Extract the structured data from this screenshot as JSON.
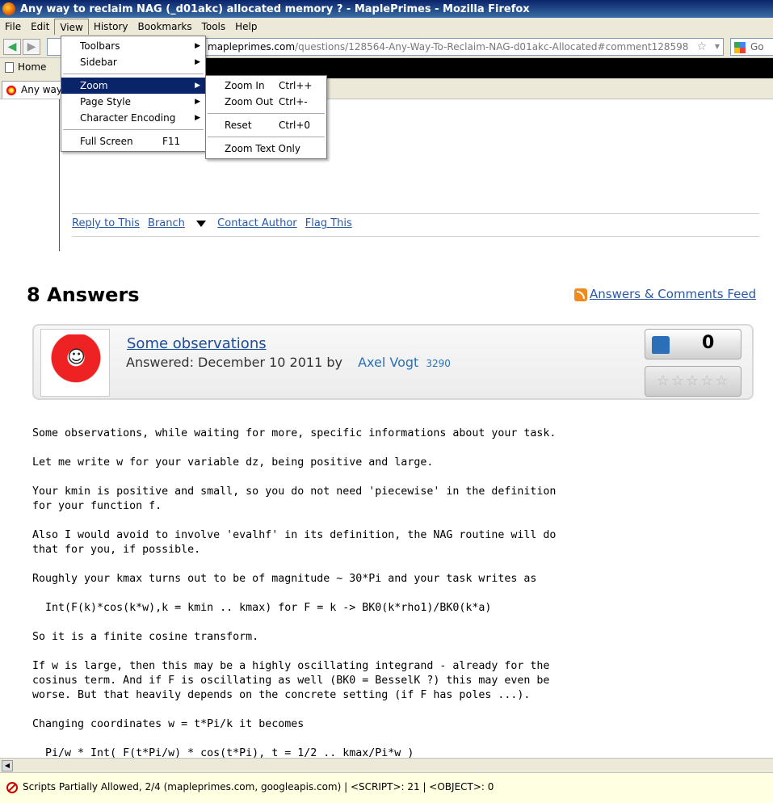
{
  "window": {
    "title": "Any way to reclaim NAG (_d01akc) allocated memory ? - MaplePrimes - Mozilla Firefox"
  },
  "menubar": {
    "items": [
      {
        "label": "File",
        "key": "F"
      },
      {
        "label": "Edit",
        "key": "E"
      },
      {
        "label": "View",
        "key": "V"
      },
      {
        "label": "History",
        "key": "s"
      },
      {
        "label": "Bookmarks",
        "key": "B"
      },
      {
        "label": "Tools",
        "key": "T"
      },
      {
        "label": "Help",
        "key": "H"
      }
    ]
  },
  "navbar": {
    "url_host": "mapleprimes.com",
    "url_path": "/questions/128564-Any-Way-To-Reclaim-NAG-d01akc-Allocated#comment128598",
    "search_placeholder": "Go"
  },
  "bookmarks": {
    "home": "Home"
  },
  "tab": {
    "label": "Any way"
  },
  "view_menu": {
    "items": [
      {
        "label": "Toolbars",
        "submenu": true
      },
      {
        "label": "Sidebar",
        "submenu": true
      },
      {
        "label": "Zoom",
        "submenu": true,
        "highlighted": true
      },
      {
        "label": "Page Style",
        "submenu": true
      },
      {
        "label": "Character Encoding",
        "submenu": true
      },
      {
        "label": "Full Screen",
        "shortcut": "F11"
      }
    ]
  },
  "zoom_menu": {
    "items": [
      {
        "label": "Zoom In",
        "shortcut": "Ctrl++"
      },
      {
        "label": "Zoom Out",
        "shortcut": "Ctrl+-"
      },
      {
        "label": "Reset",
        "shortcut": "Ctrl+0"
      },
      {
        "label": "Zoom Text Only"
      }
    ]
  },
  "comment_actions": {
    "reply": "Reply to This",
    "branch": "Branch",
    "contact": "Contact Author",
    "flag": "Flag This"
  },
  "answers": {
    "heading": "8 Answers",
    "feed_link": "Answers & Comments Feed"
  },
  "answer": {
    "title": "Some observations",
    "answered_label": "Answered: December 10 2011 by",
    "author": "Axel Vogt",
    "reputation": "3290",
    "votes": "0",
    "stars": "☆☆☆☆☆",
    "body": "Some observations, while waiting for more, specific informations about your task.\n\nLet me write w for your variable dz, being positive and large.\n\nYour kmin is positive and small, so you do not need 'piecewise' in the definition\nfor your function f.\n\nAlso I would avoid to involve 'evalhf' in its definition, the NAG routine will do\nthat for you, if possible.\n\nRoughly your kmax turns out to be of magnitude ~ 30*Pi and your task writes as\n\n  Int(F(k)*cos(k*w),k = kmin .. kmax) for F = k -> BK0(k*rho1)/BK0(k*a)\n\nSo it is a finite cosine transform.\n\nIf w is large, then this may be a highly oscillating integrand - already for the\ncosinus term. And if F is oscillating as well (BK0 = BesselK ?) this may even be\nworse. But that heavily depends on the concrete setting (if F has poles ...).\n\nChanging coordinates w = t*Pi/k it becomes\n\n  Pi/w * Int( F(t*Pi/w) * cos(t*Pi), t = 1/2 .. kmax/Pi*w )"
  },
  "statusbar": {
    "message": "Scripts Partially Allowed, 2/4 (mapleprimes.com, googleapis.com) | <SCRIPT>: 21 | <OBJECT>: 0"
  },
  "colors": {
    "link": "#2a58a8",
    "menu_highlight": "#0a246a",
    "status_background": "#ffffe1"
  }
}
